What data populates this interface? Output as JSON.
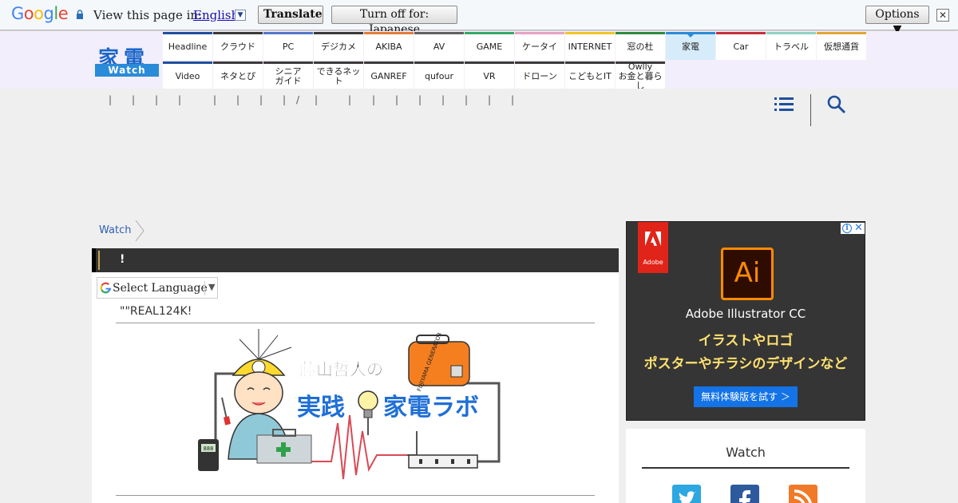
{
  "translate_bar": {
    "logo_letters": [
      "G",
      "o",
      "o",
      "g",
      "l",
      "e"
    ],
    "prompt": "View this page in:",
    "language": "English",
    "dropdown_glyph": "▼",
    "translate_label": "Translate",
    "turn_off_label": "Turn off for: Japanese",
    "options_label": "Options ▼",
    "close_glyph": "✕"
  },
  "site": {
    "logo_kanji": "家電",
    "logo_sub": "Watch",
    "nav_row1": [
      {
        "label": "Headline",
        "color": "#1f4f9e"
      },
      {
        "label": "クラウド",
        "color": "#3a3a3a"
      },
      {
        "label": "PC",
        "color": "#5277c9"
      },
      {
        "label": "デジカメ",
        "color": "#3a3a3a"
      },
      {
        "label": "AKIBA",
        "color": "#e27b3b"
      },
      {
        "label": "AV",
        "color": "#606060"
      },
      {
        "label": "GAME",
        "color": "#35a967"
      },
      {
        "label": "ケータイ",
        "color": "#e6a3c2"
      },
      {
        "label": "INTERNET",
        "color": "#f0c428"
      },
      {
        "label": "窓の杜",
        "color": "#2e8a3e"
      },
      {
        "label": "家電",
        "color": "#2a8bd8"
      },
      {
        "label": "Car",
        "color": "#c3313a"
      },
      {
        "label": "トラベル",
        "color": "#8fd3c1"
      },
      {
        "label": "仮想通貨",
        "color": "#e0a634"
      }
    ],
    "nav_row2": [
      {
        "label": "Video",
        "color": "#1f4f9e"
      },
      {
        "label": "ネタとぴ",
        "color": "#3a3a3a"
      },
      {
        "label": "シニア\nガイド",
        "color": "#3a3a3a"
      },
      {
        "label": "できるネット",
        "color": "#3a3a3a"
      },
      {
        "label": "GANREF",
        "color": "#3a3a3a"
      },
      {
        "label": "qufour",
        "color": "#3a3a3a"
      },
      {
        "label": "VR",
        "color": "#3a3a3a"
      },
      {
        "label": "ドローン",
        "color": "#3a3a3a"
      },
      {
        "label": "こどもとIT",
        "color": "#3a3a3a"
      },
      {
        "label": "Owlly\nお金と暮らし",
        "color": "#3a3a3a"
      }
    ],
    "active_nav": "家電",
    "separators": [
      "|",
      "|",
      "|",
      "|",
      "|",
      "|",
      "|",
      "|",
      "/",
      "|",
      "|",
      "|",
      "|",
      "|",
      "|",
      "|",
      "|",
      "|"
    ]
  },
  "breadcrumb": {
    "home": "Watch"
  },
  "article": {
    "title": "!",
    "select_language": "Select Language",
    "select_arrow": "▼",
    "subtitle": "\"\"REAL124K!",
    "banner": {
      "title_line1": "藤山哲人の",
      "title_line2a": "実践",
      "title_line2b": "家電ラボ",
      "generator_label": "FUJIYAMA GENERATOR",
      "meter_readout": "888"
    }
  },
  "ad": {
    "info_glyph": "i",
    "close_glyph": "✕",
    "brand": "Adobe",
    "app_mark": "Ai",
    "product": "Adobe Illustrator CC",
    "line1": "イラストやロゴ",
    "line2": "ポスターやチラシのデザインなど",
    "cta": "無料体験版を試す ＞"
  },
  "sidebar": {
    "title": "Watch",
    "socials": [
      "twitter-icon",
      "facebook-icon",
      "rss-icon"
    ],
    "colors": {
      "twitter": "#2ca7e0",
      "facebook": "#2d5a9c",
      "rss": "#f07a28"
    }
  }
}
